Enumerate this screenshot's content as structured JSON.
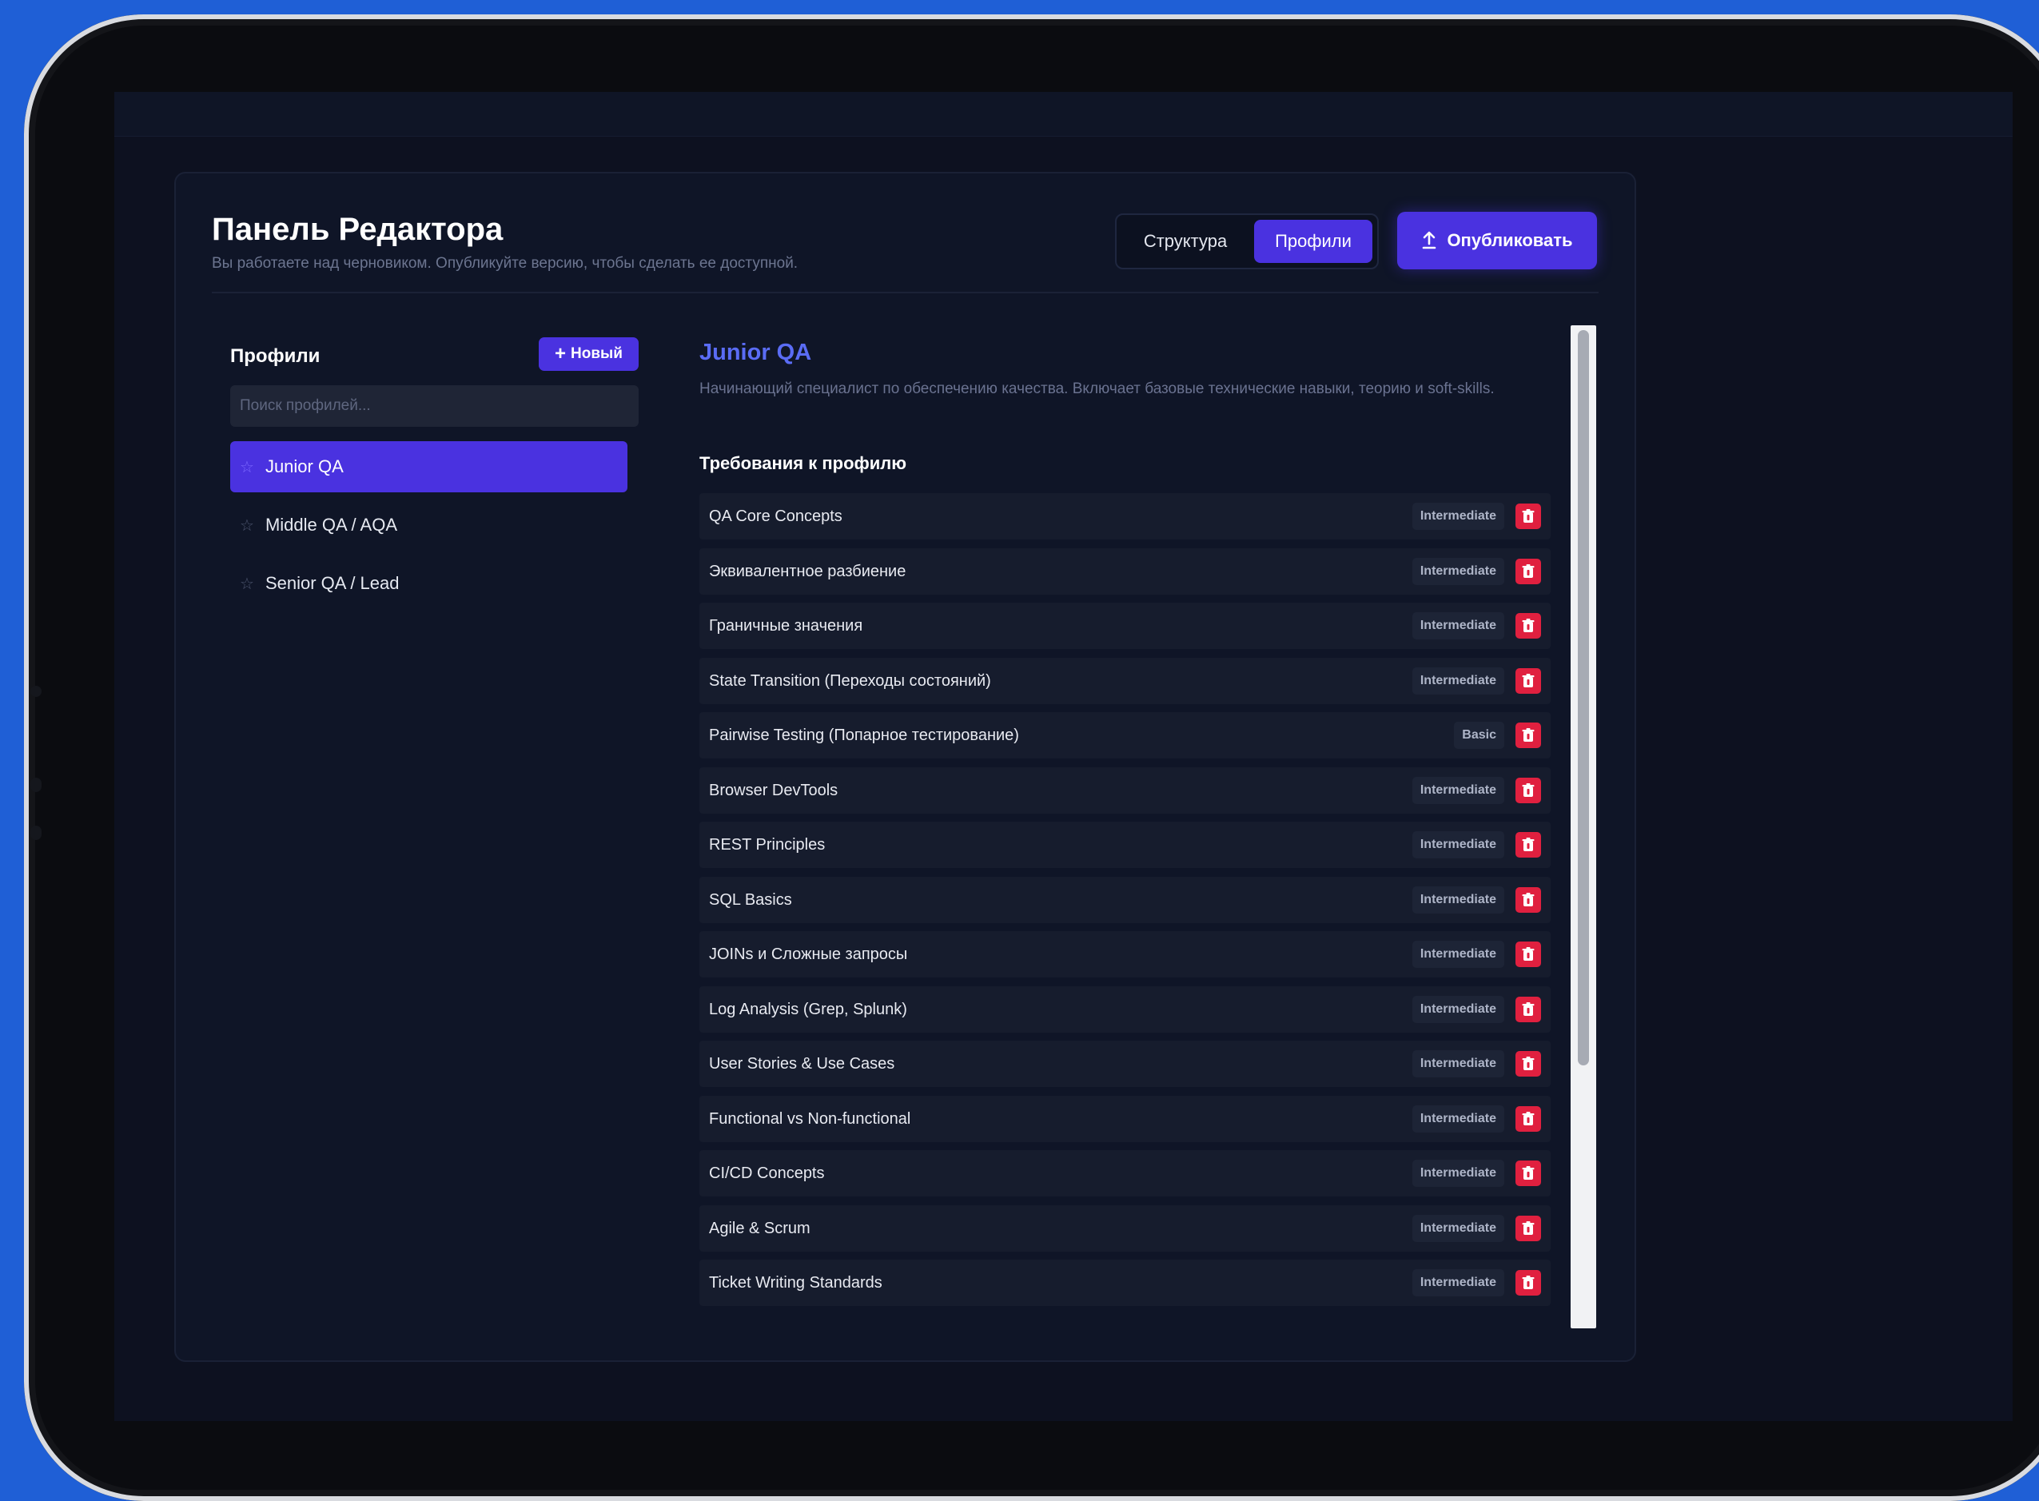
{
  "header": {
    "title": "Панель Редактора",
    "subtitle": "Вы работаете над черновиком. Опубликуйте версию, чтобы сделать ее доступной.",
    "tabs": [
      {
        "label": "Структура",
        "active": false
      },
      {
        "label": "Профили",
        "active": true
      }
    ],
    "publish_label": "Опубликовать",
    "publish_icon": "upload-icon"
  },
  "sidebar": {
    "title": "Профили",
    "new_button_label": "Новый",
    "search_placeholder": "Поиск профилей...",
    "items": [
      {
        "label": "Junior QA",
        "active": true
      },
      {
        "label": "Middle QA / AQA",
        "active": false
      },
      {
        "label": "Senior QA / Lead",
        "active": false
      }
    ]
  },
  "profile": {
    "title": "Junior QA",
    "description": "Начинающий специалист по обеспечению качества. Включает базовые технические навыки, теорию и soft-skills.",
    "requirements_title": "Требования к профилю",
    "requirements": [
      {
        "name": "QA Core Concepts",
        "level": "Intermediate"
      },
      {
        "name": "Эквивалентное разбиение",
        "level": "Intermediate"
      },
      {
        "name": "Граничные значения",
        "level": "Intermediate"
      },
      {
        "name": "State Transition (Переходы состояний)",
        "level": "Intermediate"
      },
      {
        "name": "Pairwise Testing (Попарное тестирование)",
        "level": "Basic"
      },
      {
        "name": "Browser DevTools",
        "level": "Intermediate"
      },
      {
        "name": "REST Principles",
        "level": "Intermediate"
      },
      {
        "name": "SQL Basics",
        "level": "Intermediate"
      },
      {
        "name": "JOINs и Сложные запросы",
        "level": "Intermediate"
      },
      {
        "name": "Log Analysis (Grep, Splunk)",
        "level": "Intermediate"
      },
      {
        "name": "User Stories & Use Cases",
        "level": "Intermediate"
      },
      {
        "name": "Functional vs Non-functional",
        "level": "Intermediate"
      },
      {
        "name": "CI/CD Concepts",
        "level": "Intermediate"
      },
      {
        "name": "Agile & Scrum",
        "level": "Intermediate"
      },
      {
        "name": "Ticket Writing Standards",
        "level": "Intermediate"
      }
    ]
  },
  "colors": {
    "accent": "#4a32e0",
    "title_accent": "#5a6cf5",
    "danger": "#e0203f",
    "background": "#0d1120",
    "outer": "#1f5fd6"
  }
}
